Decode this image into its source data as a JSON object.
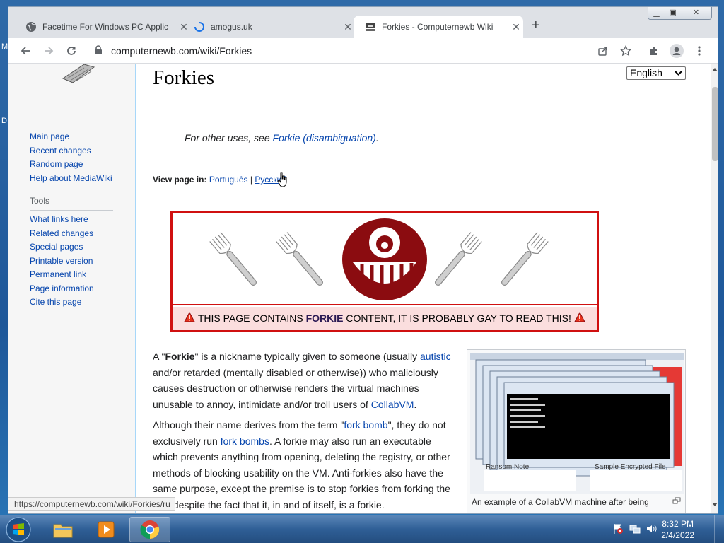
{
  "desktop": {
    "fragment_1": "M",
    "fragment_2": "D"
  },
  "browser": {
    "tabs": [
      {
        "title": "Facetime For Windows PC Applic",
        "favicon": "globe-icon",
        "active": false
      },
      {
        "title": "amogus.uk",
        "favicon": "loading-spinner-icon",
        "active": false
      },
      {
        "title": "Forkies - Computernewb Wiki",
        "favicon": "wiki-logo-icon",
        "active": true
      }
    ],
    "close_glyph": "✕",
    "new_tab_glyph": "+",
    "url": "computernewb.com/wiki/Forkies",
    "status_url": "https://computernewb.com/wiki/Forkies/ru"
  },
  "sidebar": {
    "nav": [
      "Main page",
      "Recent changes",
      "Random page",
      "Help about MediaWiki"
    ],
    "tools_heading": "Tools",
    "tools": [
      "What links here",
      "Related changes",
      "Special pages",
      "Printable version",
      "Permanent link",
      "Page information",
      "Cite this page"
    ]
  },
  "page": {
    "title": "Forkies",
    "language_select": "English",
    "hatnote": {
      "prefix": "For other uses, see ",
      "link": "Forkie (disambiguation)",
      "suffix": "."
    },
    "view_in": {
      "label": "View page in:",
      "langs": [
        "Português",
        "Русский"
      ],
      "sep": "|"
    },
    "banner": {
      "text_before": "THIS PAGE CONTAINS ",
      "text_bold": "FORKIE",
      "text_after": " CONTENT, IT IS PROBABLY GAY TO READ THIS!"
    },
    "para1": {
      "a": "A \"",
      "b": "Forkie",
      "c": "\" is a nickname typically given to someone (usually ",
      "link1": "autistic",
      "d": " and/or retarded (mentally disabled or otherwise)) who maliciously causes destruction or otherwise renders the virtual machines unusable to annoy, intimidate and/or troll users of ",
      "link2": "CollabVM",
      "e": "."
    },
    "para2": {
      "a": "Although their name derives from the term \"",
      "link1": "fork bomb",
      "b": "\", they do not exclusively run ",
      "link2": "fork bombs",
      "c": ". A forkie may also run an executable which prevents anything from opening, deleting the registry, or other methods of blocking usability on the VM. Anti-forkies also have the same purpose, except the premise is to stop forkies from forking the VM, despite the fact that it, in and of itself, is a forkie."
    },
    "thumb_caption": "An example of a CollabVM machine after being",
    "thumb_labels": {
      "left": "Ransom Note",
      "right": "Sample Encrypted File"
    }
  },
  "taskbar": {
    "time": "8:32 PM",
    "date": "2/4/2022"
  }
}
